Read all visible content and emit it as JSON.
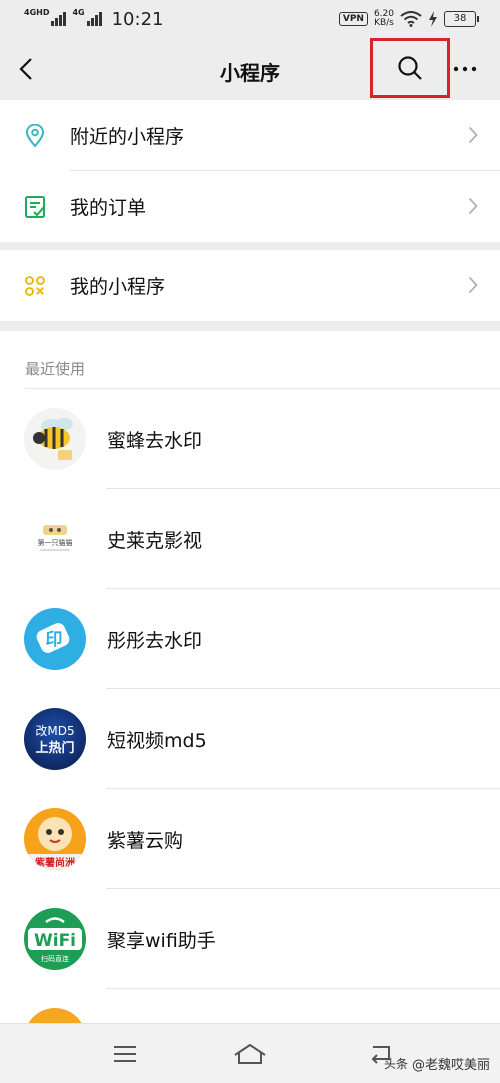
{
  "status_bar": {
    "sim1": "4GHD",
    "sim2": "4G",
    "time": "10:21",
    "vpn": "VPN",
    "speed_value": "6.20",
    "speed_unit": "KB/s",
    "battery": "38"
  },
  "nav": {
    "title": "小程序",
    "back_icon": "chevron-left-icon",
    "search_icon": "search-icon",
    "more_icon": "more-dots-icon",
    "highlight_color": "#d9232b"
  },
  "menu": [
    {
      "label": "附近的小程序",
      "icon": "location-pin-icon",
      "color": "#3cb6c4"
    },
    {
      "label": "我的订单",
      "icon": "order-list-icon",
      "color": "#1aad5c"
    },
    {
      "label": "我的小程序",
      "icon": "grid-apps-icon",
      "color": "#e6b800"
    }
  ],
  "recent": {
    "heading": "最近使用",
    "apps": [
      {
        "name": "蜜蜂去水印",
        "icon": "bee-icon"
      },
      {
        "name": "史莱克影视",
        "icon": "cat-logo-icon",
        "logo_text": "第一只猫猫"
      },
      {
        "name": "彤彤去水印",
        "icon": "stamp-icon",
        "logo_text": "印"
      },
      {
        "name": "短视频md5",
        "icon": "md5-logo-icon",
        "logo_line1": "改MD5",
        "logo_line2": "上热门"
      },
      {
        "name": "紫薯云购",
        "icon": "sweet-potato-icon",
        "logo_text": "紫薯尚洲"
      },
      {
        "name": "聚享wifi助手",
        "icon": "wifi-logo-icon",
        "logo_text": "WiFi",
        "logo_sub": "扫码直连"
      }
    ]
  },
  "bottom_nav": {
    "menu_icon": "menu-lines-icon",
    "home_icon": "home-icon",
    "back_icon": "return-icon",
    "watermark_prefix": "头条",
    "watermark": "@老魏哎美丽"
  }
}
